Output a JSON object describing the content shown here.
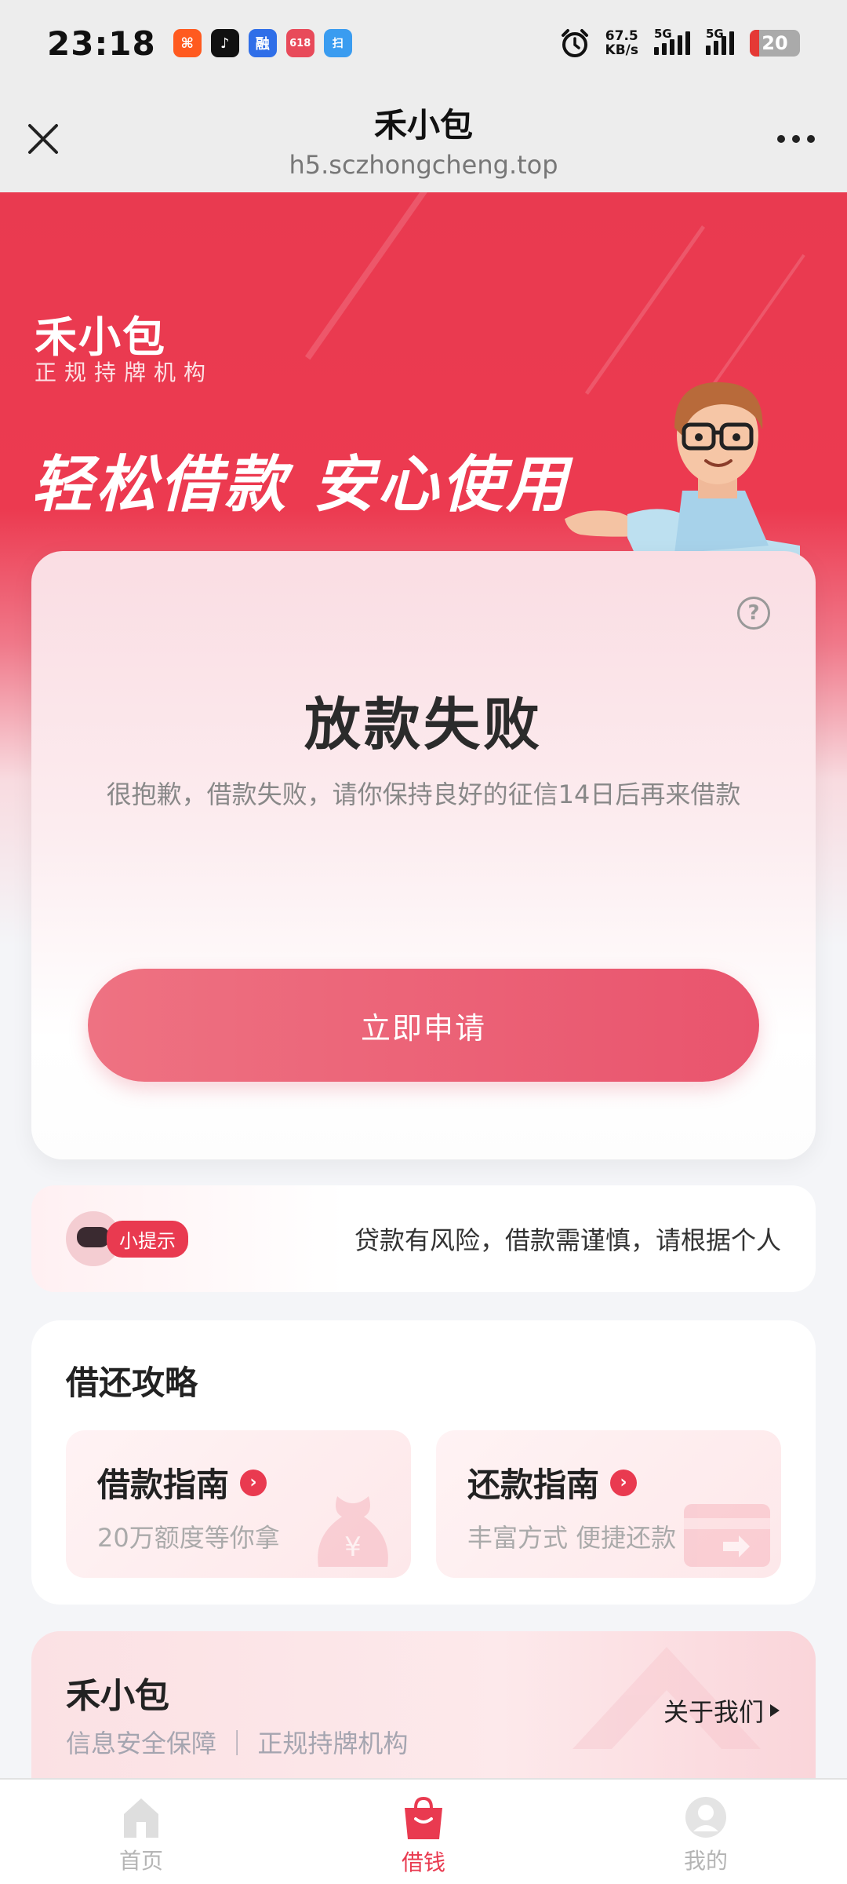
{
  "status_bar": {
    "time": "23:18",
    "net_speed_value": "67.5",
    "net_speed_unit": "KB/s",
    "signal1_label": "5G",
    "signal2_label": "5G",
    "battery": "20",
    "app_icon_1": "⌘",
    "app_icon_2": "♪",
    "app_icon_3": "融",
    "app_icon_4": "618",
    "app_icon_5": "扫"
  },
  "header": {
    "title": "禾小包",
    "url": "h5.sczhongcheng.top"
  },
  "hero": {
    "brand_name": "禾小包",
    "brand_sub": "正规持牌机构",
    "slogan": "轻松借款 安心使用"
  },
  "result_card": {
    "title": "放款失败",
    "message": "很抱歉，借款失败，请你保持良好的征信14日后再来借款",
    "help_glyph": "?",
    "apply_button": "立即申请"
  },
  "tip": {
    "badge": "小提示",
    "text": "贷款有风险，借款需谨慎，请根据个人"
  },
  "guides": {
    "title": "借还攻略",
    "items": [
      {
        "title": "借款指南",
        "subtitle": "20万额度等你拿",
        "arrow": "›"
      },
      {
        "title": "还款指南",
        "subtitle": "丰富方式 便捷还款",
        "arrow": "›"
      }
    ]
  },
  "about": {
    "title": "禾小包",
    "subtitle": "信息安全保障 ｜ 正规持牌机构",
    "link": "关于我们"
  },
  "bottom_nav": {
    "items": [
      {
        "label": "首页",
        "active": false
      },
      {
        "label": "借钱",
        "active": true
      },
      {
        "label": "我的",
        "active": false
      }
    ]
  },
  "colors": {
    "brand_red": "#e93a50",
    "button_gradient_start": "#ee7282",
    "button_gradient_end": "#e9546d"
  }
}
